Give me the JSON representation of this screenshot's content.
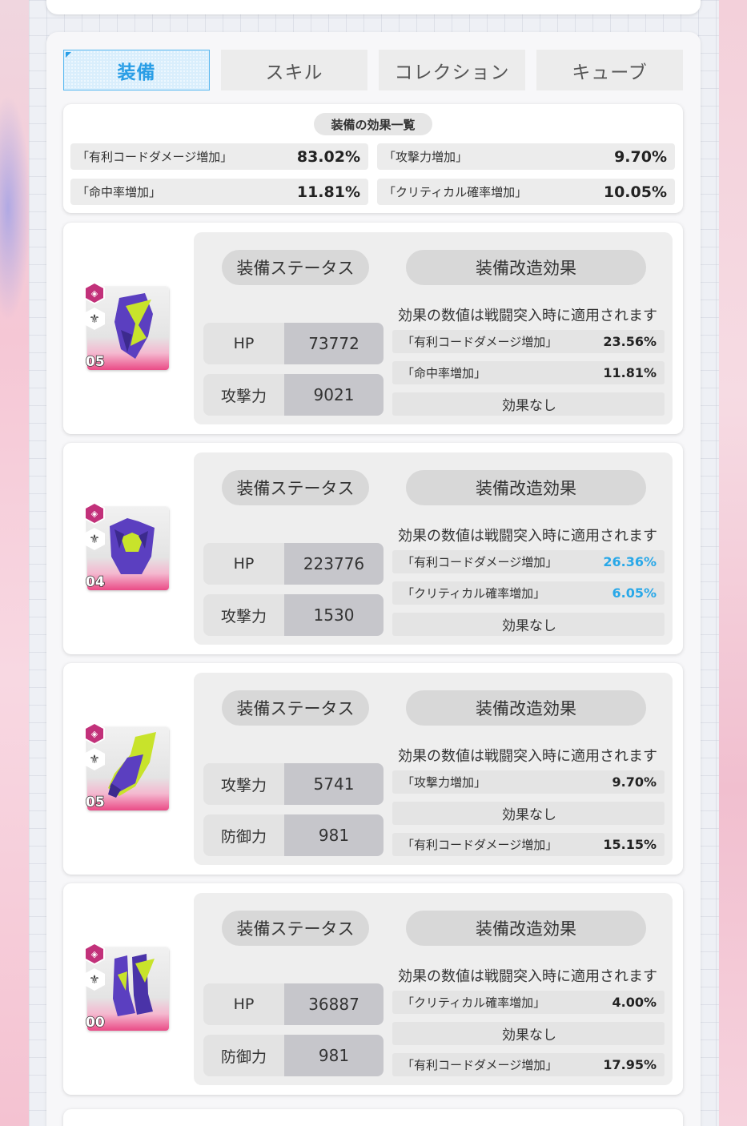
{
  "tabs": [
    {
      "label": "装備",
      "active": true
    },
    {
      "label": "スキル",
      "active": false
    },
    {
      "label": "コレクション",
      "active": false
    },
    {
      "label": "キューブ",
      "active": false
    }
  ],
  "summary": {
    "title": "装備の効果一覧",
    "rows": [
      {
        "label": "「有利コードダメージ増加」",
        "value": "83.02%"
      },
      {
        "label": "「攻撃力増加」",
        "value": "9.70%"
      },
      {
        "label": "「命中率増加」",
        "value": "11.81%"
      },
      {
        "label": "「クリティカル確率増加」",
        "value": "10.05%"
      }
    ]
  },
  "common": {
    "status_title": "装備ステータス",
    "mod_title": "装備改造効果",
    "mod_note": "効果の数値は戦闘突入時に適用されます",
    "no_effect": "効果なし"
  },
  "equipment": [
    {
      "level": "05",
      "icon": "helmet-icon",
      "stats": [
        {
          "label": "HP",
          "value": "73772"
        },
        {
          "label": "攻撃力",
          "value": "9021"
        }
      ],
      "mods": [
        {
          "label": "「有利コードダメージ増加」",
          "value": "23.56%",
          "highlight": false
        },
        {
          "label": "「命中率増加」",
          "value": "11.81%",
          "highlight": false
        },
        {
          "label": "効果なし",
          "value": "",
          "none": true
        }
      ]
    },
    {
      "level": "04",
      "icon": "armor-icon",
      "stats": [
        {
          "label": "HP",
          "value": "223776"
        },
        {
          "label": "攻撃力",
          "value": "1530"
        }
      ],
      "mods": [
        {
          "label": "「有利コードダメージ増加」",
          "value": "26.36%",
          "highlight": true
        },
        {
          "label": "「クリティカル確率増加」",
          "value": "6.05%",
          "highlight": true
        },
        {
          "label": "効果なし",
          "value": "",
          "none": true
        }
      ]
    },
    {
      "level": "05",
      "icon": "gauntlet-icon",
      "stats": [
        {
          "label": "攻撃力",
          "value": "5741"
        },
        {
          "label": "防御力",
          "value": "981"
        }
      ],
      "mods": [
        {
          "label": "「攻撃力増加」",
          "value": "9.70%",
          "highlight": false
        },
        {
          "label": "効果なし",
          "value": "",
          "none": true
        },
        {
          "label": "「有利コードダメージ増加」",
          "value": "15.15%",
          "highlight": false
        }
      ]
    },
    {
      "level": "00",
      "icon": "boots-icon",
      "stats": [
        {
          "label": "HP",
          "value": "36887"
        },
        {
          "label": "防御力",
          "value": "981"
        }
      ],
      "mods": [
        {
          "label": "「クリティカル確率増加」",
          "value": "4.00%",
          "highlight": false
        },
        {
          "label": "効果なし",
          "value": "",
          "none": true
        },
        {
          "label": "「有利コードダメージ増加」",
          "value": "17.95%",
          "highlight": false
        }
      ]
    }
  ],
  "colors": {
    "accent_blue": "#29a8e8",
    "tab_active_bg": "#d9eefc",
    "equip_purple": "#5b3fc0",
    "equip_lime": "#c8e32b",
    "rarity_pink": "#c2317a"
  }
}
